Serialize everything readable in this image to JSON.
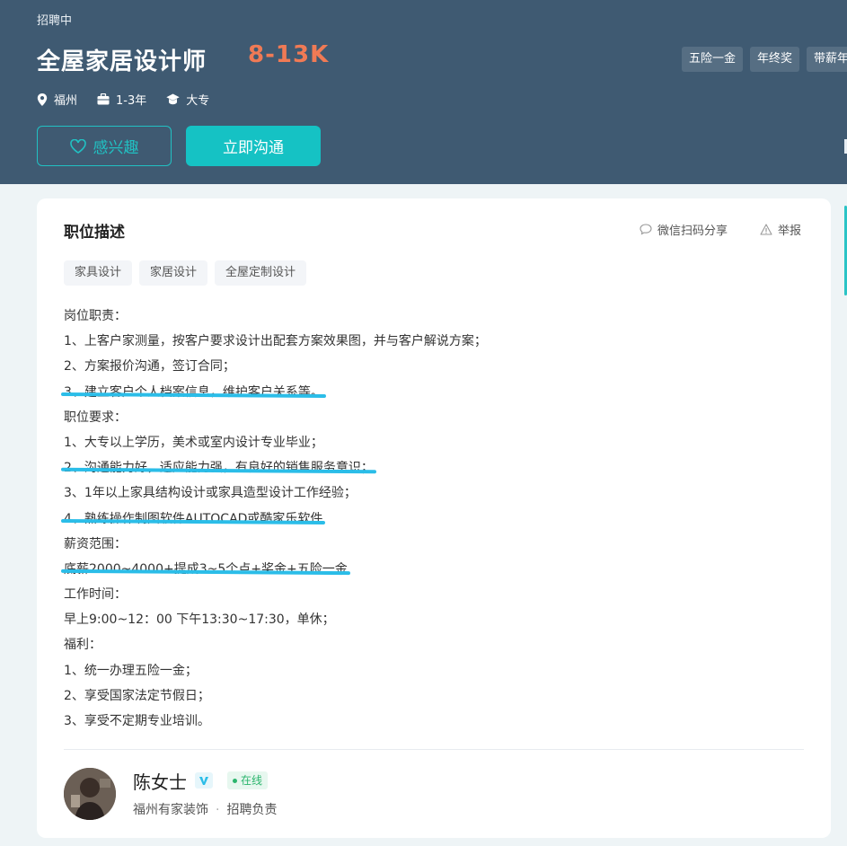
{
  "header": {
    "status": "招聘中",
    "title": "全屋家居设计师",
    "salary": "8-13K",
    "location": "福州",
    "experience": "1-3年",
    "education": "大专",
    "welfare": [
      "五险一金",
      "年终奖",
      "带薪年假"
    ],
    "interest_label": "感兴趣",
    "chat_label": "立即沟通"
  },
  "card": {
    "section_title": "职位描述",
    "share_label": "微信扫码分享",
    "report_label": "举报",
    "skills": [
      "家具设计",
      "家居设计",
      "全屋定制设计"
    ],
    "description": [
      "岗位职责：",
      "1、上客户家测量，按客户要求设计出配套方案效果图，并与客户解说方案；",
      "2、方案报价沟通，签订合同；",
      "3、建立客户个人档案信息，维护客户关系等。",
      "职位要求：",
      "1、大专以上学历，美术或室内设计专业毕业；",
      "2、沟通能力好，适应能力强，有良好的销售服务意识；",
      "3、1年以上家具结构设计或家具造型设计工作经验；",
      "4、熟练操作制图软件AUTOCAD或酷家乐软件",
      "薪资范围：",
      "底薪2000~4000+提成3~5个点+奖金+五险一金",
      "工作时间：",
      "早上9:00~12：00 下午13:30~17:30，单休；",
      "福利：",
      "1、统一办理五险一金；",
      "2、享受国家法定节假日；",
      "3、享受不定期专业培训。"
    ],
    "recruiter": {
      "name": "陈女士",
      "online": "在线",
      "company": "福州有家装饰",
      "role": "招聘负责"
    }
  },
  "colors": {
    "header_bg": "#3f5a72",
    "salary": "#f07a55",
    "accent": "#15c2c4",
    "highlight": "#2bbde8"
  }
}
